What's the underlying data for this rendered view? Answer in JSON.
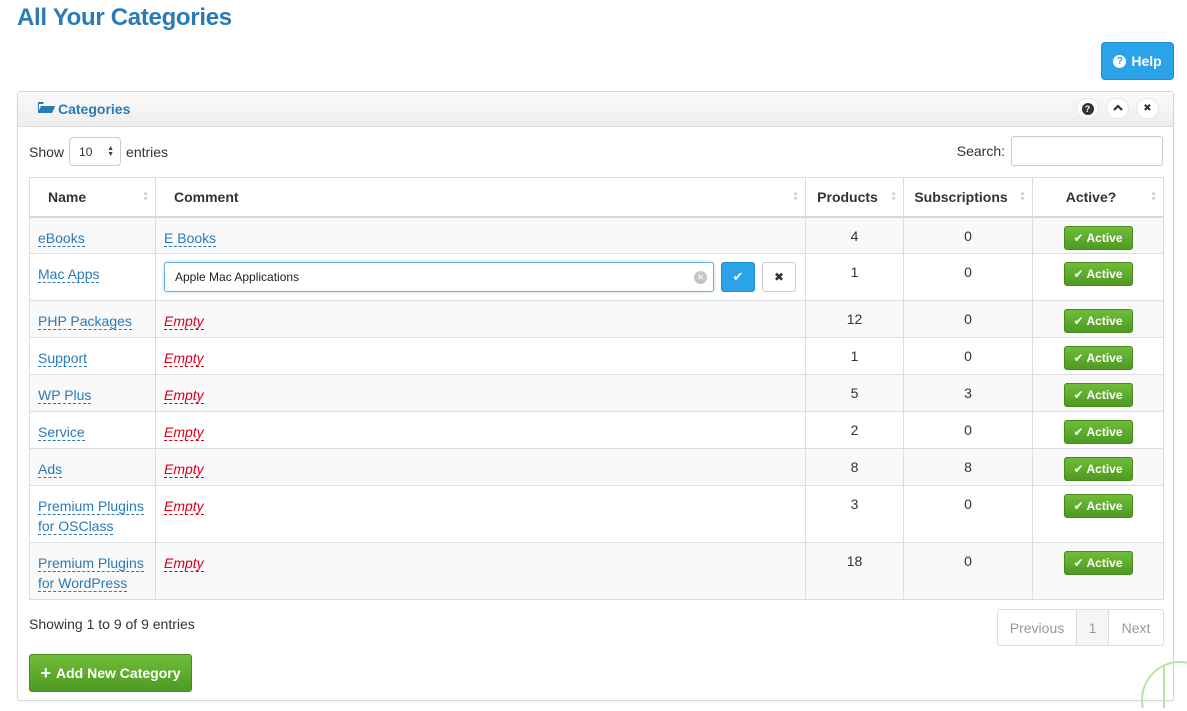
{
  "page": {
    "title": "All Your Categories",
    "help_label": "Help"
  },
  "box": {
    "title": "Categories"
  },
  "controls": {
    "show_label": "Show",
    "page_length": "10",
    "entries_label": "entries",
    "search_label": "Search:",
    "search_value": ""
  },
  "table": {
    "headers": [
      "Name",
      "Comment",
      "Products",
      "Subscriptions",
      "Active?"
    ],
    "empty_label": "Empty",
    "active_label": "Active",
    "rows": [
      {
        "name": "eBooks",
        "comment": "E Books",
        "products": "4",
        "subscriptions": "0"
      },
      {
        "name": "Mac Apps",
        "comment": "Apple Mac Applications",
        "products": "1",
        "subscriptions": "0"
      },
      {
        "name": "PHP Packages",
        "comment": "Empty",
        "products": "12",
        "subscriptions": "0"
      },
      {
        "name": "Support",
        "comment": "Empty",
        "products": "1",
        "subscriptions": "0"
      },
      {
        "name": "WP Plus",
        "comment": "Empty",
        "products": "5",
        "subscriptions": "3"
      },
      {
        "name": "Service",
        "comment": "Empty",
        "products": "2",
        "subscriptions": "0"
      },
      {
        "name": "Ads",
        "comment": "Empty",
        "products": "8",
        "subscriptions": "8"
      },
      {
        "name": "Premium Plugins for OSClass",
        "comment": "Empty",
        "products": "3",
        "subscriptions": "0"
      },
      {
        "name": "Premium Plugins for WordPress",
        "comment": "Empty",
        "products": "18",
        "subscriptions": "0"
      }
    ]
  },
  "footer": {
    "info": "Showing 1 to 9 of 9 entries",
    "prev_label": "Previous",
    "current_page": "1",
    "next_label": "Next",
    "add_label": "Add New Category"
  },
  "colors": {
    "accent": "#2a7ab6",
    "primary_button": "#2ba3e8",
    "success": "#5aa72b",
    "empty_text": "#d9001b"
  }
}
